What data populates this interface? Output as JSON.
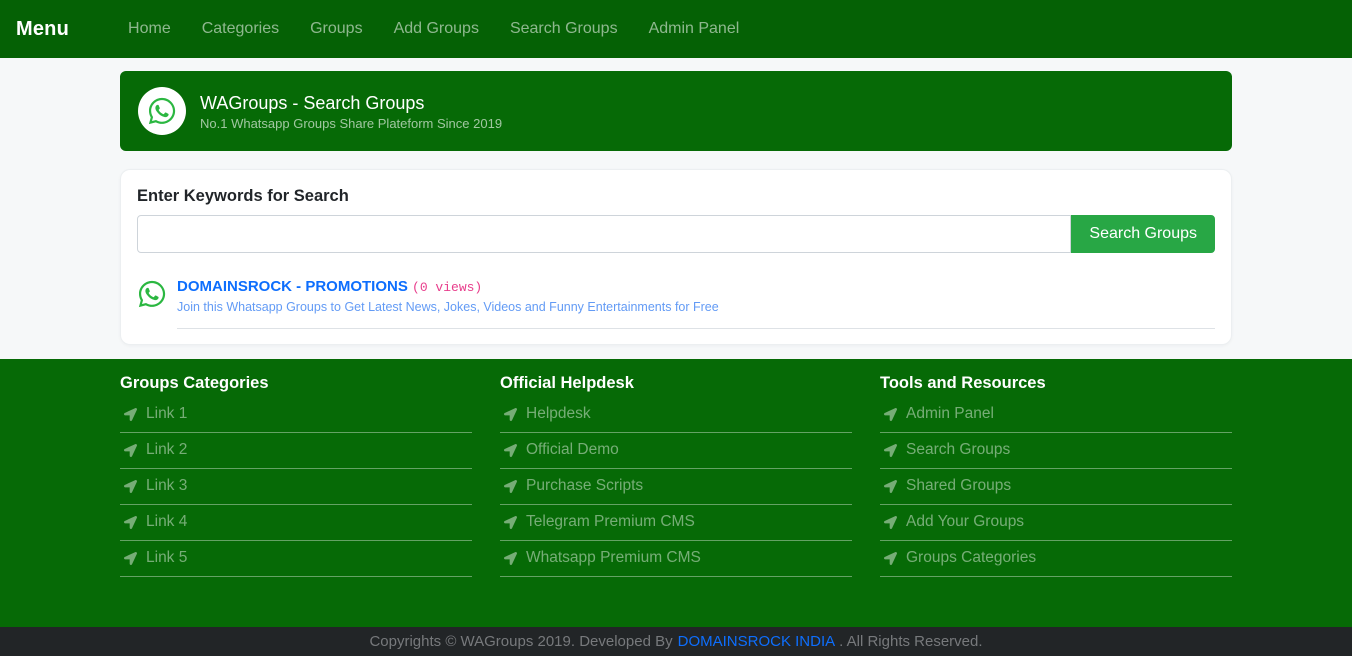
{
  "navbar": {
    "brand": "Menu",
    "links": [
      "Home",
      "Categories",
      "Groups",
      "Add Groups",
      "Search Groups",
      "Admin Panel"
    ]
  },
  "banner": {
    "title": "WAGroups - Search Groups",
    "subtitle": "No.1 Whatsapp Groups Share Plateform Since 2019"
  },
  "search": {
    "label": "Enter Keywords for Search",
    "input_value": "",
    "button_label": "Search Groups"
  },
  "result": {
    "title": "DOMAINSROCK - PROMOTIONS",
    "views": "(0 views)",
    "description": "Join this Whatsapp Groups to Get Latest News, Jokes, Videos and Funny Entertainments for Free"
  },
  "footer": {
    "columns": [
      {
        "title": "Groups Categories",
        "links": [
          "Link 1",
          "Link 2",
          "Link 3",
          "Link 4",
          "Link 5"
        ]
      },
      {
        "title": "Official Helpdesk",
        "links": [
          "Helpdesk",
          "Official Demo",
          "Purchase Scripts",
          "Telegram Premium CMS",
          "Whatsapp Premium CMS"
        ]
      },
      {
        "title": "Tools and Resources",
        "links": [
          "Admin Panel",
          "Search Groups",
          "Shared Groups",
          "Add Your Groups",
          "Groups Categories"
        ]
      }
    ]
  },
  "copyright": {
    "prefix": "Copyrights © WAGroups 2019. Developed By",
    "link": "DOMAINSROCK INDIA",
    "suffix": ". All Rights Reserved."
  },
  "colors": {
    "navbar_green": "#056105",
    "banner_green": "#066a06",
    "footer_green": "#066a06",
    "button_green": "#28a745",
    "whatsapp_green": "#2bb741",
    "link_blue": "#0d6efd",
    "views_pink": "#e83e8c",
    "copyright_bg": "#222527"
  }
}
